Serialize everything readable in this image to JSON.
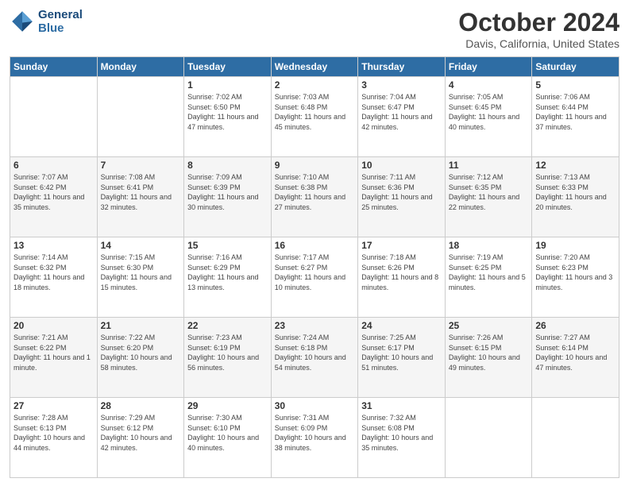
{
  "logo": {
    "line1": "General",
    "line2": "Blue"
  },
  "title": "October 2024",
  "subtitle": "Davis, California, United States",
  "days_header": [
    "Sunday",
    "Monday",
    "Tuesday",
    "Wednesday",
    "Thursday",
    "Friday",
    "Saturday"
  ],
  "weeks": [
    [
      {
        "num": "",
        "sunrise": "",
        "sunset": "",
        "daylight": ""
      },
      {
        "num": "",
        "sunrise": "",
        "sunset": "",
        "daylight": ""
      },
      {
        "num": "1",
        "sunrise": "Sunrise: 7:02 AM",
        "sunset": "Sunset: 6:50 PM",
        "daylight": "Daylight: 11 hours and 47 minutes."
      },
      {
        "num": "2",
        "sunrise": "Sunrise: 7:03 AM",
        "sunset": "Sunset: 6:48 PM",
        "daylight": "Daylight: 11 hours and 45 minutes."
      },
      {
        "num": "3",
        "sunrise": "Sunrise: 7:04 AM",
        "sunset": "Sunset: 6:47 PM",
        "daylight": "Daylight: 11 hours and 42 minutes."
      },
      {
        "num": "4",
        "sunrise": "Sunrise: 7:05 AM",
        "sunset": "Sunset: 6:45 PM",
        "daylight": "Daylight: 11 hours and 40 minutes."
      },
      {
        "num": "5",
        "sunrise": "Sunrise: 7:06 AM",
        "sunset": "Sunset: 6:44 PM",
        "daylight": "Daylight: 11 hours and 37 minutes."
      }
    ],
    [
      {
        "num": "6",
        "sunrise": "Sunrise: 7:07 AM",
        "sunset": "Sunset: 6:42 PM",
        "daylight": "Daylight: 11 hours and 35 minutes."
      },
      {
        "num": "7",
        "sunrise": "Sunrise: 7:08 AM",
        "sunset": "Sunset: 6:41 PM",
        "daylight": "Daylight: 11 hours and 32 minutes."
      },
      {
        "num": "8",
        "sunrise": "Sunrise: 7:09 AM",
        "sunset": "Sunset: 6:39 PM",
        "daylight": "Daylight: 11 hours and 30 minutes."
      },
      {
        "num": "9",
        "sunrise": "Sunrise: 7:10 AM",
        "sunset": "Sunset: 6:38 PM",
        "daylight": "Daylight: 11 hours and 27 minutes."
      },
      {
        "num": "10",
        "sunrise": "Sunrise: 7:11 AM",
        "sunset": "Sunset: 6:36 PM",
        "daylight": "Daylight: 11 hours and 25 minutes."
      },
      {
        "num": "11",
        "sunrise": "Sunrise: 7:12 AM",
        "sunset": "Sunset: 6:35 PM",
        "daylight": "Daylight: 11 hours and 22 minutes."
      },
      {
        "num": "12",
        "sunrise": "Sunrise: 7:13 AM",
        "sunset": "Sunset: 6:33 PM",
        "daylight": "Daylight: 11 hours and 20 minutes."
      }
    ],
    [
      {
        "num": "13",
        "sunrise": "Sunrise: 7:14 AM",
        "sunset": "Sunset: 6:32 PM",
        "daylight": "Daylight: 11 hours and 18 minutes."
      },
      {
        "num": "14",
        "sunrise": "Sunrise: 7:15 AM",
        "sunset": "Sunset: 6:30 PM",
        "daylight": "Daylight: 11 hours and 15 minutes."
      },
      {
        "num": "15",
        "sunrise": "Sunrise: 7:16 AM",
        "sunset": "Sunset: 6:29 PM",
        "daylight": "Daylight: 11 hours and 13 minutes."
      },
      {
        "num": "16",
        "sunrise": "Sunrise: 7:17 AM",
        "sunset": "Sunset: 6:27 PM",
        "daylight": "Daylight: 11 hours and 10 minutes."
      },
      {
        "num": "17",
        "sunrise": "Sunrise: 7:18 AM",
        "sunset": "Sunset: 6:26 PM",
        "daylight": "Daylight: 11 hours and 8 minutes."
      },
      {
        "num": "18",
        "sunrise": "Sunrise: 7:19 AM",
        "sunset": "Sunset: 6:25 PM",
        "daylight": "Daylight: 11 hours and 5 minutes."
      },
      {
        "num": "19",
        "sunrise": "Sunrise: 7:20 AM",
        "sunset": "Sunset: 6:23 PM",
        "daylight": "Daylight: 11 hours and 3 minutes."
      }
    ],
    [
      {
        "num": "20",
        "sunrise": "Sunrise: 7:21 AM",
        "sunset": "Sunset: 6:22 PM",
        "daylight": "Daylight: 11 hours and 1 minute."
      },
      {
        "num": "21",
        "sunrise": "Sunrise: 7:22 AM",
        "sunset": "Sunset: 6:20 PM",
        "daylight": "Daylight: 10 hours and 58 minutes."
      },
      {
        "num": "22",
        "sunrise": "Sunrise: 7:23 AM",
        "sunset": "Sunset: 6:19 PM",
        "daylight": "Daylight: 10 hours and 56 minutes."
      },
      {
        "num": "23",
        "sunrise": "Sunrise: 7:24 AM",
        "sunset": "Sunset: 6:18 PM",
        "daylight": "Daylight: 10 hours and 54 minutes."
      },
      {
        "num": "24",
        "sunrise": "Sunrise: 7:25 AM",
        "sunset": "Sunset: 6:17 PM",
        "daylight": "Daylight: 10 hours and 51 minutes."
      },
      {
        "num": "25",
        "sunrise": "Sunrise: 7:26 AM",
        "sunset": "Sunset: 6:15 PM",
        "daylight": "Daylight: 10 hours and 49 minutes."
      },
      {
        "num": "26",
        "sunrise": "Sunrise: 7:27 AM",
        "sunset": "Sunset: 6:14 PM",
        "daylight": "Daylight: 10 hours and 47 minutes."
      }
    ],
    [
      {
        "num": "27",
        "sunrise": "Sunrise: 7:28 AM",
        "sunset": "Sunset: 6:13 PM",
        "daylight": "Daylight: 10 hours and 44 minutes."
      },
      {
        "num": "28",
        "sunrise": "Sunrise: 7:29 AM",
        "sunset": "Sunset: 6:12 PM",
        "daylight": "Daylight: 10 hours and 42 minutes."
      },
      {
        "num": "29",
        "sunrise": "Sunrise: 7:30 AM",
        "sunset": "Sunset: 6:10 PM",
        "daylight": "Daylight: 10 hours and 40 minutes."
      },
      {
        "num": "30",
        "sunrise": "Sunrise: 7:31 AM",
        "sunset": "Sunset: 6:09 PM",
        "daylight": "Daylight: 10 hours and 38 minutes."
      },
      {
        "num": "31",
        "sunrise": "Sunrise: 7:32 AM",
        "sunset": "Sunset: 6:08 PM",
        "daylight": "Daylight: 10 hours and 35 minutes."
      },
      {
        "num": "",
        "sunrise": "",
        "sunset": "",
        "daylight": ""
      },
      {
        "num": "",
        "sunrise": "",
        "sunset": "",
        "daylight": ""
      }
    ]
  ]
}
